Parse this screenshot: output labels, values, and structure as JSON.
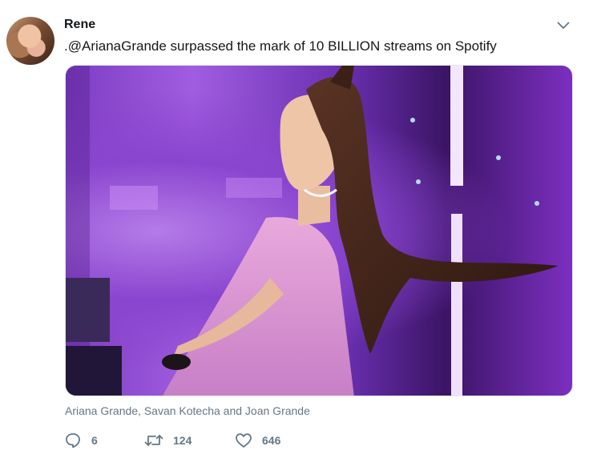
{
  "tweet": {
    "author_name": "Rene",
    "text": ".@ArianaGrande surpassed the mark of 10 BILLION streams on Spotify",
    "photo_credit": "Ariana Grande, Savan Kotecha and Joan Grande",
    "replies": "6",
    "retweets": "124",
    "likes": "646"
  },
  "icons": {
    "menu": "chevron-down-icon",
    "reply": "speech-bubble-icon",
    "retweet": "retweet-arrows-icon",
    "like": "heart-icon"
  },
  "colors": {
    "text": "#14171a",
    "secondary": "#657786",
    "border": "#e1e8ed",
    "photo_accent": "#a15de0"
  }
}
